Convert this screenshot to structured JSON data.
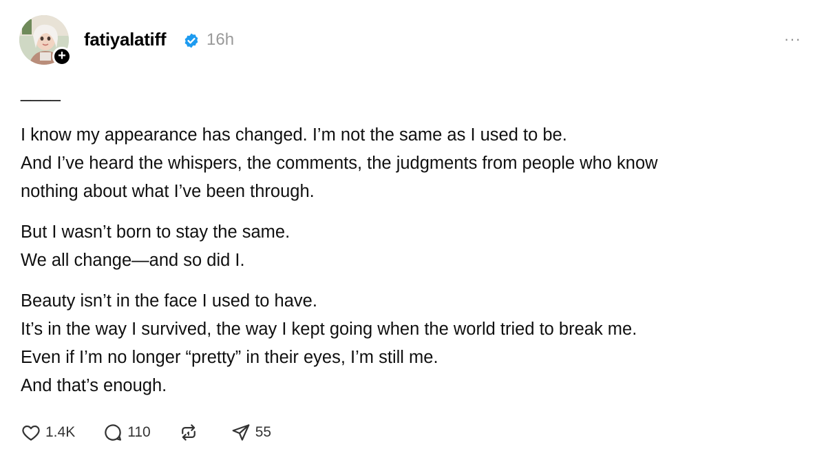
{
  "post": {
    "username": "fatiyalatiff",
    "timestamp": "16h",
    "more_label": "···",
    "follow_label": "+",
    "divider": "____",
    "paragraphs": [
      [
        "I know my appearance has changed. I’m not the same as I used to be.",
        "And I’ve heard the whispers, the comments, the judgments from people who know",
        "nothing about what I’ve been through."
      ],
      [
        "But I wasn’t born to stay the same.",
        "We all change—and so did I."
      ],
      [
        "Beauty isn’t in the face I used to have.",
        "It’s in the way I survived, the way I kept going when the world tried to break me.",
        "Even if I’m no longer “pretty” in their eyes, I’m still me.",
        "And that’s enough."
      ]
    ],
    "actions": {
      "likes": "1.4K",
      "comments": "110",
      "reposts": "",
      "shares": "55"
    },
    "icons": {
      "verified": "verified-badge-icon",
      "like": "heart-icon",
      "comment": "comment-bubble-icon",
      "repost": "repost-icon",
      "share": "send-icon"
    },
    "colors": {
      "verified": "#1d9bf0",
      "timestamp": "#999999"
    }
  }
}
